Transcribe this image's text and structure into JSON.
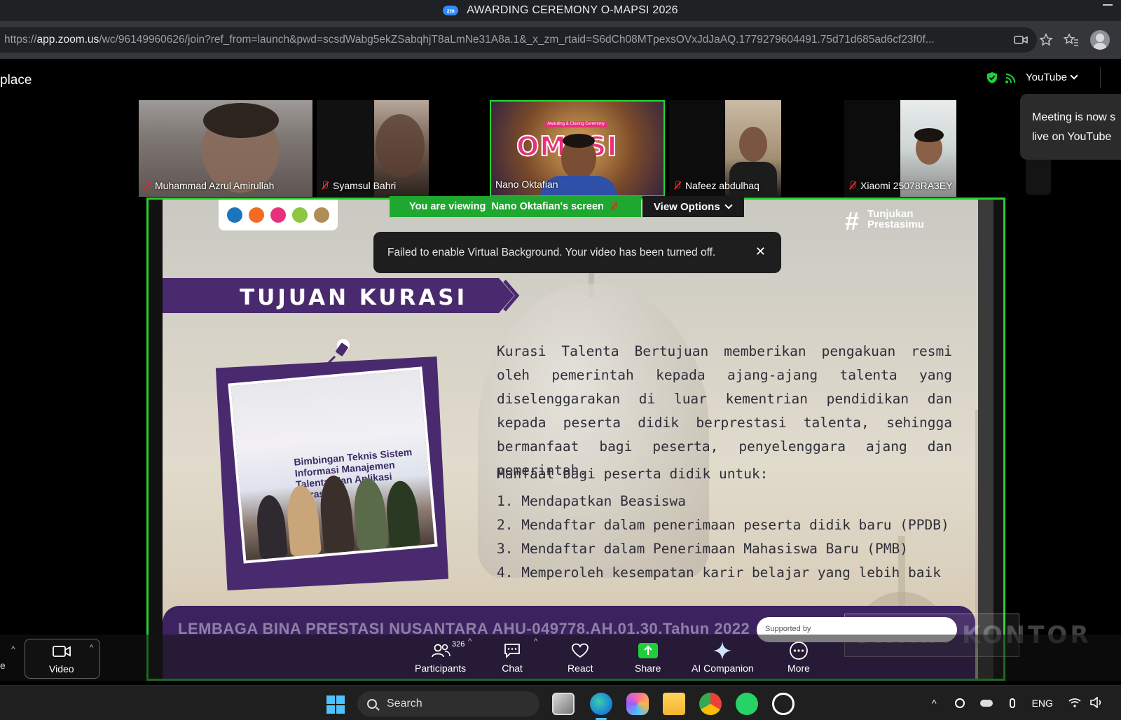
{
  "browser": {
    "window_title": "AWARDING CEREMONY O-MAPSI 2026",
    "zoom_badge": "zm",
    "url_prefix": "https://",
    "url_host": "app.zoom.us",
    "url_rest": "/wc/96149960626/join?ref_from=launch&pwd=scsdWabg5ekZSabqhjT8aLmNe31A8a.1&_x_zm_rtaid=S6dCh08MTpexsOVxJdJaAQ.1779279604491.75d71d685ad6cf23f0f..."
  },
  "meeting": {
    "place_label": "place",
    "live_dropdown": "YouTube",
    "live_toast_line1": "Meeting is now s",
    "live_toast_line2": "live on YouTube"
  },
  "participants": [
    {
      "name": "Muhammad Azrul Amirullah",
      "muted": true
    },
    {
      "name": "Syamsul Bahri",
      "muted": true
    },
    {
      "name": "Nano Oktafian",
      "muted": false,
      "active_speaker": true
    },
    {
      "name": "Nafeez abdulhaq",
      "muted": true
    },
    {
      "name": "Xiaomi 25078RA3EY",
      "muted": true
    }
  ],
  "speaker_overlay": {
    "logo": "OMPSI",
    "tag": "Awarding & Closing Ceremony"
  },
  "share": {
    "viewing_prefix": "You are viewing",
    "viewing_name": "Nano Oktafian's screen",
    "view_options": "View Options",
    "toast_message": "Failed to enable Virtual Background. Your video has been turned off.",
    "toast_close": "✕"
  },
  "slide": {
    "hashtag": "#",
    "hashtag_line1": "Tunjukan",
    "hashtag_line2": "Prestasimu",
    "heading": "TUJUAN KURASI",
    "paragraph": "Kurasi Talenta Bertujuan memberikan pengakuan resmi oleh pemerintah kepada ajang-ajang talenta yang diselenggarakan di luar kementrian pendidikan dan kepada peserta didik berprestasi talenta, sehingga bermanfaat bagi peserta, penyelenggara ajang dan pemerintah.",
    "benefits_title": "Manfaat bagi peserta didik untuk:",
    "benefits": [
      "1. Mendapatkan Beasiswa",
      "2. Mendaftar dalam penerimaan peserta didik baru (PPDB)",
      "3. Mendaftar dalam Penerimaan Mahasiswa Baru (PMB)",
      "4. Memperoleh kesempatan karir belajar yang lebih baik"
    ],
    "photo_banner": "Bimbingan Teknis Sistem Informasi Manajemen Talenta, dan Aplikasi Kurasi",
    "footer": "LEMBAGA BINA PRESTASI NUSANTARA AHU-049778.AH.01.30.Tahun 2022",
    "supported_by": "Supported by",
    "logo_colors": [
      "#1c75bc",
      "#f26b21",
      "#e8317a",
      "#8dc63f",
      "#b08d57"
    ]
  },
  "toolbar": {
    "video": "Video",
    "participants": "Participants",
    "participants_count": "326",
    "chat": "Chat",
    "react": "React",
    "share": "Share",
    "ai_companion": "AI Companion",
    "more": "More",
    "edge_label": "e"
  },
  "watermark": "UNIRA KONTOR",
  "taskbar": {
    "search": "Search",
    "language": "ENG"
  },
  "colors": {
    "active_speaker_border": "#27d02b",
    "viewing_bar": "#1fa82f",
    "slide_purple": "#4a2a6e",
    "share_green": "#1fcf3a"
  }
}
